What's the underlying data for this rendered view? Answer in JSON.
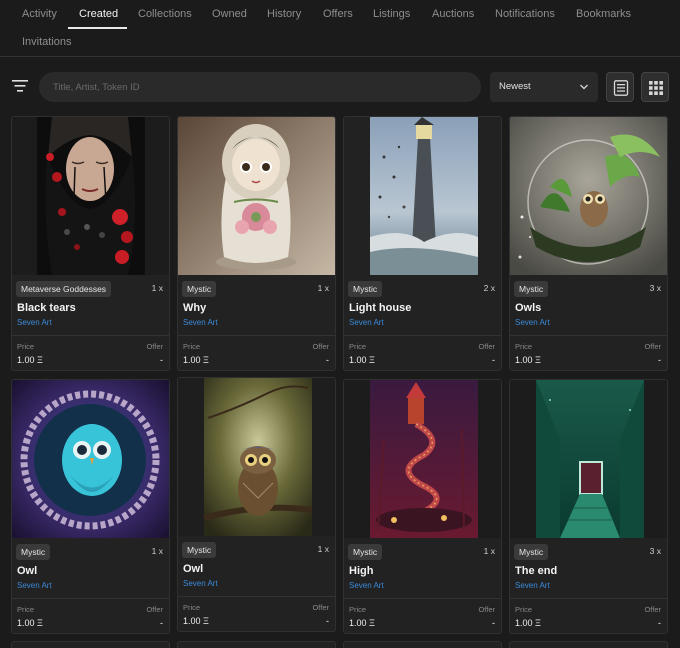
{
  "tabs": [
    {
      "label": "Activity",
      "active": false
    },
    {
      "label": "Created",
      "active": true
    },
    {
      "label": "Collections",
      "active": false
    },
    {
      "label": "Owned",
      "active": false
    },
    {
      "label": "History",
      "active": false
    },
    {
      "label": "Offers",
      "active": false
    },
    {
      "label": "Listings",
      "active": false
    },
    {
      "label": "Auctions",
      "active": false
    },
    {
      "label": "Notifications",
      "active": false
    },
    {
      "label": "Bookmarks",
      "active": false
    },
    {
      "label": "Invitations",
      "active": false
    }
  ],
  "search": {
    "placeholder": "Title, Artist, Token ID",
    "value": ""
  },
  "sort": {
    "selected": "Newest"
  },
  "labels": {
    "price": "Price",
    "offer": "Offer"
  },
  "cards": [
    {
      "collection": "Metaverse Goddesses",
      "quantity": "1 x",
      "title": "Black tears",
      "creator": "Seven Art",
      "price": "1.00",
      "currency_glyph": "Ξ",
      "offer": "-"
    },
    {
      "collection": "Mystic",
      "quantity": "1 x",
      "title": "Why",
      "creator": "Seven Art",
      "price": "1.00",
      "currency_glyph": "Ξ",
      "offer": "-"
    },
    {
      "collection": "Mystic",
      "quantity": "2 x",
      "title": "Light house",
      "creator": "Seven Art",
      "price": "1.00",
      "currency_glyph": "Ξ",
      "offer": "-"
    },
    {
      "collection": "Mystic",
      "quantity": "3 x",
      "title": "Owls",
      "creator": "Seven Art",
      "price": "1.00",
      "currency_glyph": "Ξ",
      "offer": "-"
    },
    {
      "collection": "Mystic",
      "quantity": "1 x",
      "title": "Owl",
      "creator": "Seven Art",
      "price": "1.00",
      "currency_glyph": "Ξ",
      "offer": "-"
    },
    {
      "collection": "Mystic",
      "quantity": "1 x",
      "title": "Owl",
      "creator": "Seven Art",
      "price": "1.00",
      "currency_glyph": "Ξ",
      "offer": "-"
    },
    {
      "collection": "Mystic",
      "quantity": "1 x",
      "title": "High",
      "creator": "Seven Art",
      "price": "1.00",
      "currency_glyph": "Ξ",
      "offer": "-"
    },
    {
      "collection": "Mystic",
      "quantity": "3 x",
      "title": "The end",
      "creator": "Seven Art",
      "price": "1.00",
      "currency_glyph": "Ξ",
      "offer": "-"
    }
  ],
  "icons": {
    "filter": "filter-icon",
    "sort_chevron": "chevron-down-icon",
    "list_view": "list-view-icon",
    "grid_view": "grid-view-icon"
  },
  "colors": {
    "background": "#1b1b1b",
    "card": "#222222",
    "creator_link": "#3b8ad9",
    "badge": "#3a3a3a"
  }
}
